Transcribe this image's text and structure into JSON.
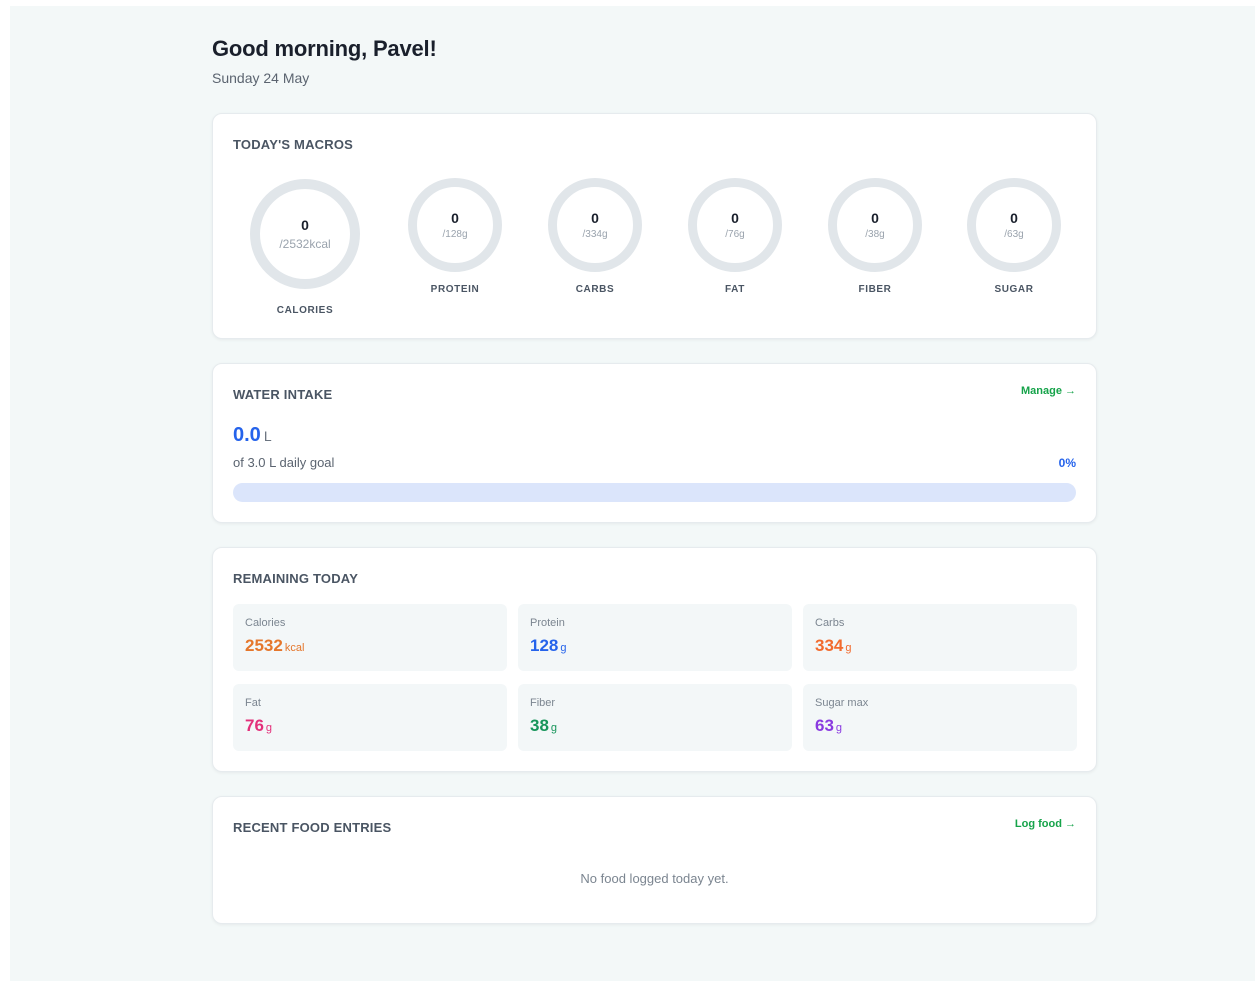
{
  "header": {
    "greeting": "Good morning, Pavel!",
    "date": "Sunday 24 May"
  },
  "macros": {
    "title": "TODAY'S MACROS",
    "ring_color": "#e1e6ea",
    "items": [
      {
        "label": "CALORIES",
        "value": "0",
        "goal": "/2532kcal"
      },
      {
        "label": "PROTEIN",
        "value": "0",
        "goal": "/128g"
      },
      {
        "label": "CARBS",
        "value": "0",
        "goal": "/334g"
      },
      {
        "label": "FAT",
        "value": "0",
        "goal": "/76g"
      },
      {
        "label": "FIBER",
        "value": "0",
        "goal": "/38g"
      },
      {
        "label": "SUGAR",
        "value": "0",
        "goal": "/63g"
      }
    ]
  },
  "water": {
    "title": "WATER INTAKE",
    "manage_label": "Manage →",
    "amount": "0.0",
    "unit": "L",
    "subtitle": "of 3.0 L daily goal",
    "percent_label": "0%",
    "progress": 0,
    "accent": "#2563eb"
  },
  "remaining": {
    "title": "REMAINING TODAY",
    "items": [
      {
        "label": "Calories",
        "value": "2532",
        "unit": "kcal",
        "color": "#e5762b"
      },
      {
        "label": "Protein",
        "value": "128",
        "unit": "g",
        "color": "#2563eb"
      },
      {
        "label": "Carbs",
        "value": "334",
        "unit": "g",
        "color": "#f26b2e"
      },
      {
        "label": "Fat",
        "value": "76",
        "unit": "g",
        "color": "#e3307a"
      },
      {
        "label": "Fiber",
        "value": "38",
        "unit": "g",
        "color": "#16955a"
      },
      {
        "label": "Sugar max",
        "value": "63",
        "unit": "g",
        "color": "#8a3ae0"
      }
    ]
  },
  "recent": {
    "title": "RECENT FOOD ENTRIES",
    "log_label": "Log food →",
    "empty_text": "No food logged today yet."
  }
}
